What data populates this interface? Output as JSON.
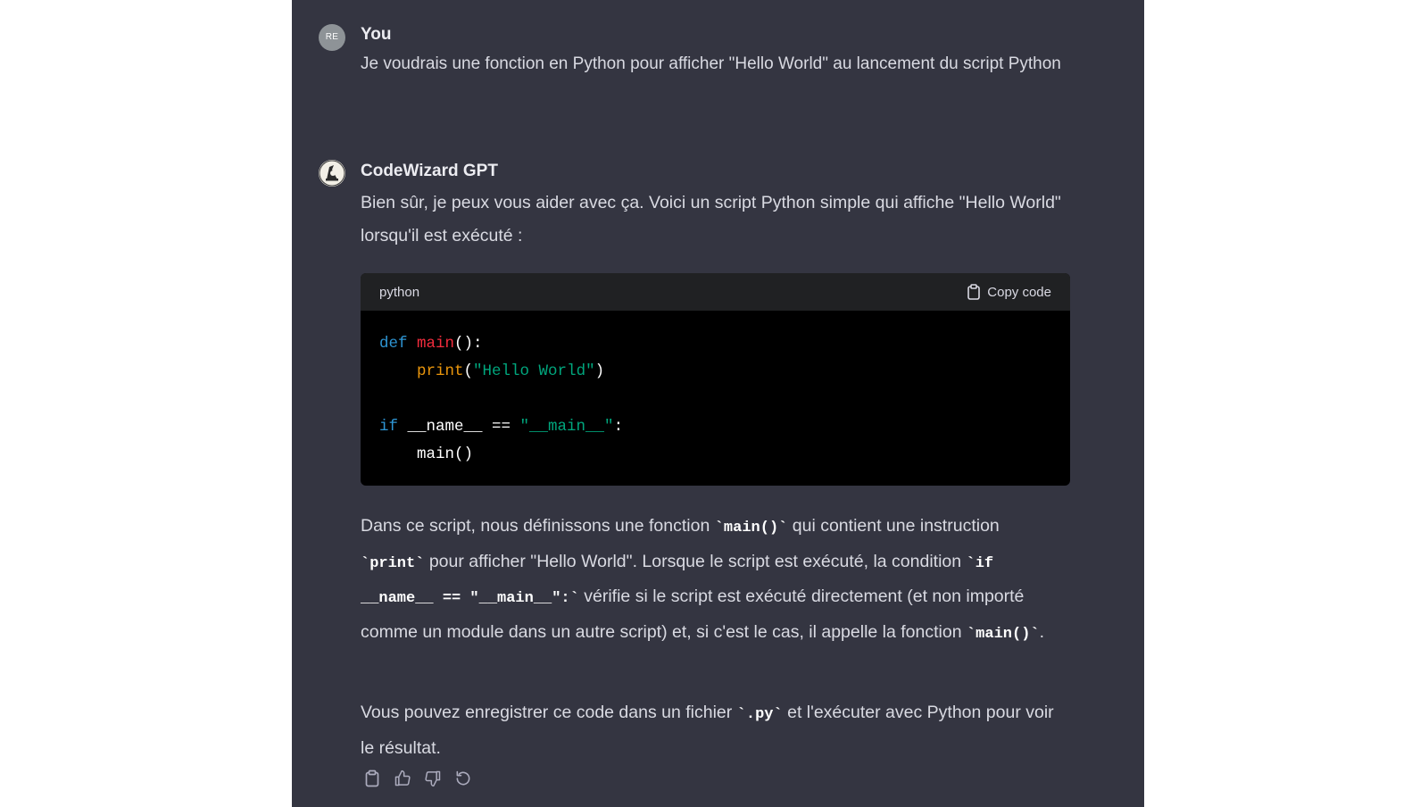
{
  "conversation": {
    "user": {
      "avatar_initials": "RE",
      "name": "You",
      "message": "Je voudrais une fonction en Python pour afficher \"Hello World\" au lancement du script Python"
    },
    "assistant": {
      "avatar_icon": "wizard-avatar-icon",
      "name": "CodeWizard GPT",
      "intro": "Bien sûr, je peux vous aider avec ça. Voici un script Python simple qui affiche \"Hello World\" lorsqu'il est exécuté :",
      "code_block": {
        "language": "python",
        "copy_label": "Copy code",
        "tokens": {
          "l1_kw": "def",
          "l1_fn": "main",
          "l1_rest": "():",
          "l2_bi": "print",
          "l2_open": "(",
          "l2_str": "\"Hello World\"",
          "l2_close": ")",
          "l4_kw": "if",
          "l4_mid": " __name__ == ",
          "l4_str": "\"__main__\"",
          "l4_end": ":",
          "l5_call": "main()"
        }
      },
      "explanation": {
        "t1": "Dans ce script, nous définissons une fonction ",
        "c1": "`main()`",
        "t2": " qui contient une instruction ",
        "c2": "`print`",
        "t3": " pour afficher \"Hello World\". Lorsque le script est exécuté, la condition ",
        "c3": "`if __name__ == \"__main__\":`",
        "t4": " vérifie si le script est exécuté directement (et non importé comme un module dans un autre script) et, si c'est le cas, il appelle la fonction ",
        "c4": "`main()`",
        "t5": "."
      },
      "closing": {
        "t1": "Vous pouvez enregistrer ce code dans un fichier ",
        "c1": "`.py`",
        "t2": " et l'exécuter avec Python pour voir le résultat."
      },
      "actions": [
        "clipboard-icon",
        "thumbs-up-icon",
        "thumbs-down-icon",
        "regenerate-icon"
      ]
    }
  },
  "colors": {
    "panel_background": "#343541",
    "code_background": "#000000",
    "code_header": "#202123",
    "keyword": "#2e95d3",
    "function_name": "#f22c3d",
    "builtin": "#e9950c",
    "string": "#00a67d"
  }
}
